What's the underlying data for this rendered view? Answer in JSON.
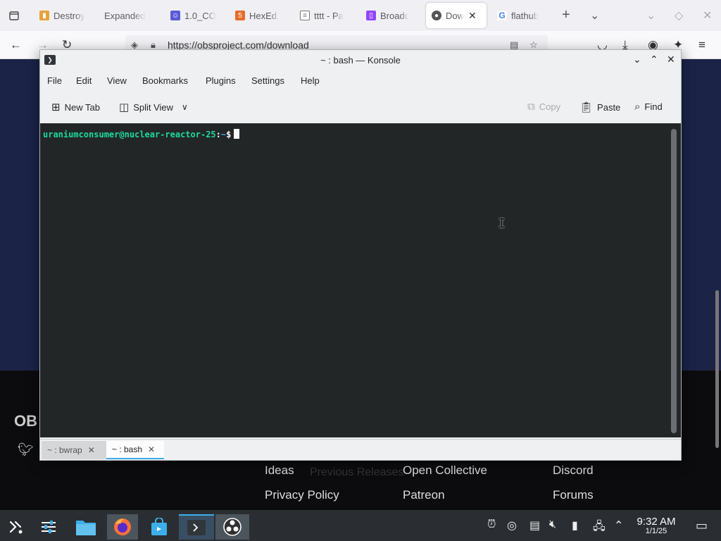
{
  "browser": {
    "tabs": [
      {
        "title": "Destroy",
        "favicon": "bookmark-icon",
        "color": "#e8a23a"
      },
      {
        "title": "Expanded",
        "favicon": "",
        "color": ""
      },
      {
        "title": "1.0_CO",
        "favicon": "robot-icon",
        "color": "#5b5bd6"
      },
      {
        "title": "HexEd.",
        "favicon": "html-icon",
        "color": "#e56d2b"
      },
      {
        "title": "tttt - Pa",
        "favicon": "page-icon",
        "color": "#777"
      },
      {
        "title": "Broadc",
        "favicon": "twitch-icon",
        "color": "#9146ff"
      },
      {
        "title": "Dow",
        "favicon": "obs-icon",
        "color": "#555"
      },
      {
        "title": "flathub",
        "favicon": "google-icon",
        "color": "#4285f4"
      }
    ],
    "url": "https://obsproject.com/download"
  },
  "webpage": {
    "logo_text": "OB",
    "links": {
      "ideas": "Ideas",
      "open_collective": "Open Collective",
      "discord": "Discord",
      "privacy_policy": "Privacy Policy",
      "patreon": "Patreon",
      "forums": "Forums"
    },
    "ghost_text": "Previous Releases"
  },
  "konsole": {
    "title": "~ : bash — Konsole",
    "menu": [
      "File",
      "Edit",
      "View",
      "Bookmarks",
      "Plugins",
      "Settings",
      "Help"
    ],
    "toolbar": {
      "new_tab": "New Tab",
      "split_view": "Split View",
      "copy": "Copy",
      "paste": "Paste",
      "find": "Find"
    },
    "prompt": {
      "user_host": "uraniumconsumer@nuclear-reactor-25",
      "separator": ":",
      "path": "~",
      "symbol": "$"
    },
    "tabs": [
      {
        "label": "~ : bwrap",
        "active": false
      },
      {
        "label": "~ : bash",
        "active": true
      }
    ],
    "colors": {
      "prompt_green": "#1cdc9a",
      "prompt_blue": "#3daee9",
      "accent": "#3daee9"
    }
  },
  "taskbar": {
    "clock_time": "9:32 AM",
    "clock_date": "1/1/25"
  }
}
